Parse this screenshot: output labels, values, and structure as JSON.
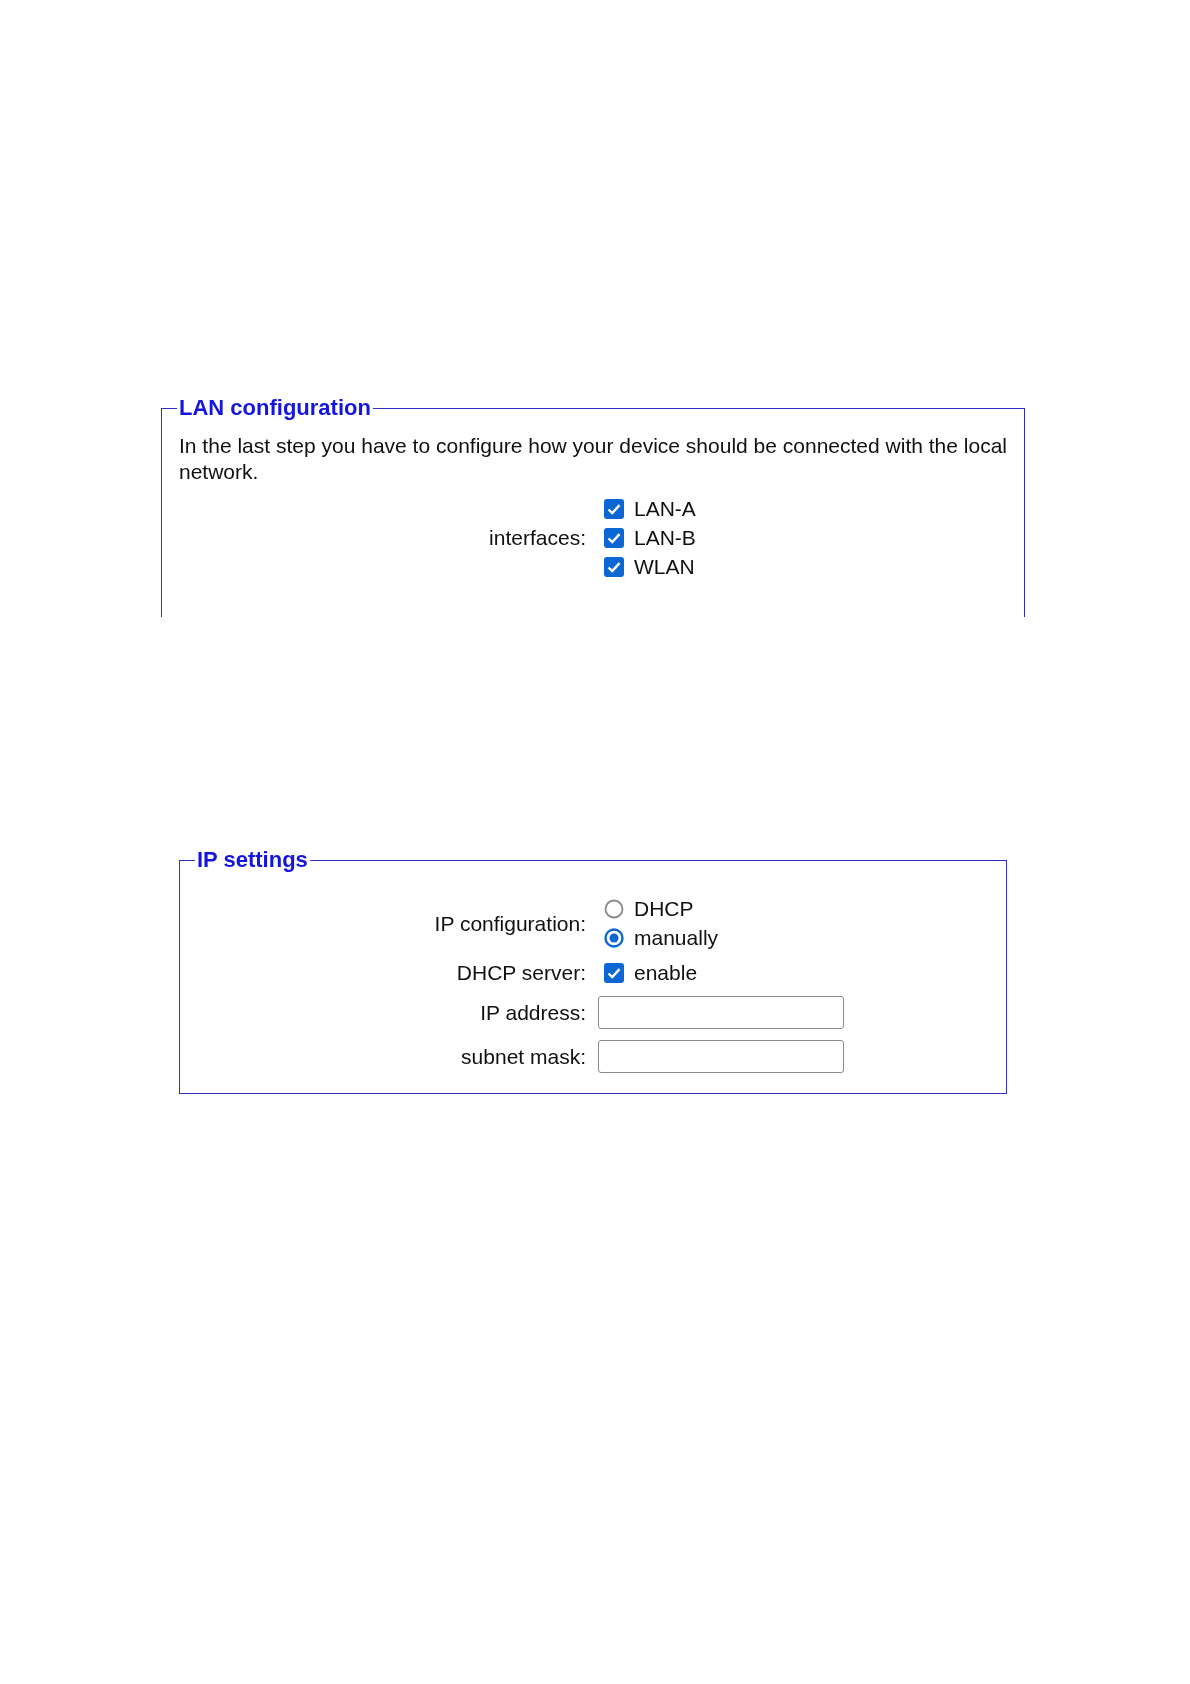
{
  "sections": [
    {
      "legend": "LAN configuration",
      "intro": "In the last step you have to configure how your device should be connected with the local network.",
      "rows": [
        {
          "kind": "checkboxes",
          "label": "interfaces:",
          "options": [
            {
              "label": "LAN-A",
              "checked": true
            },
            {
              "label": "LAN-B",
              "checked": true
            },
            {
              "label": "WLAN",
              "checked": true
            }
          ]
        }
      ]
    },
    {
      "legend": "IP settings",
      "rows": [
        {
          "kind": "radios",
          "label": "IP configuration:",
          "options": [
            {
              "label": "DHCP",
              "selected": false
            },
            {
              "label": "manually",
              "selected": true
            }
          ]
        },
        {
          "kind": "checkboxes",
          "label": "DHCP server:",
          "options": [
            {
              "label": "enable",
              "checked": true
            }
          ]
        },
        {
          "kind": "text",
          "label": "IP address:"
        },
        {
          "kind": "text",
          "label": "subnet mask:"
        }
      ]
    }
  ]
}
